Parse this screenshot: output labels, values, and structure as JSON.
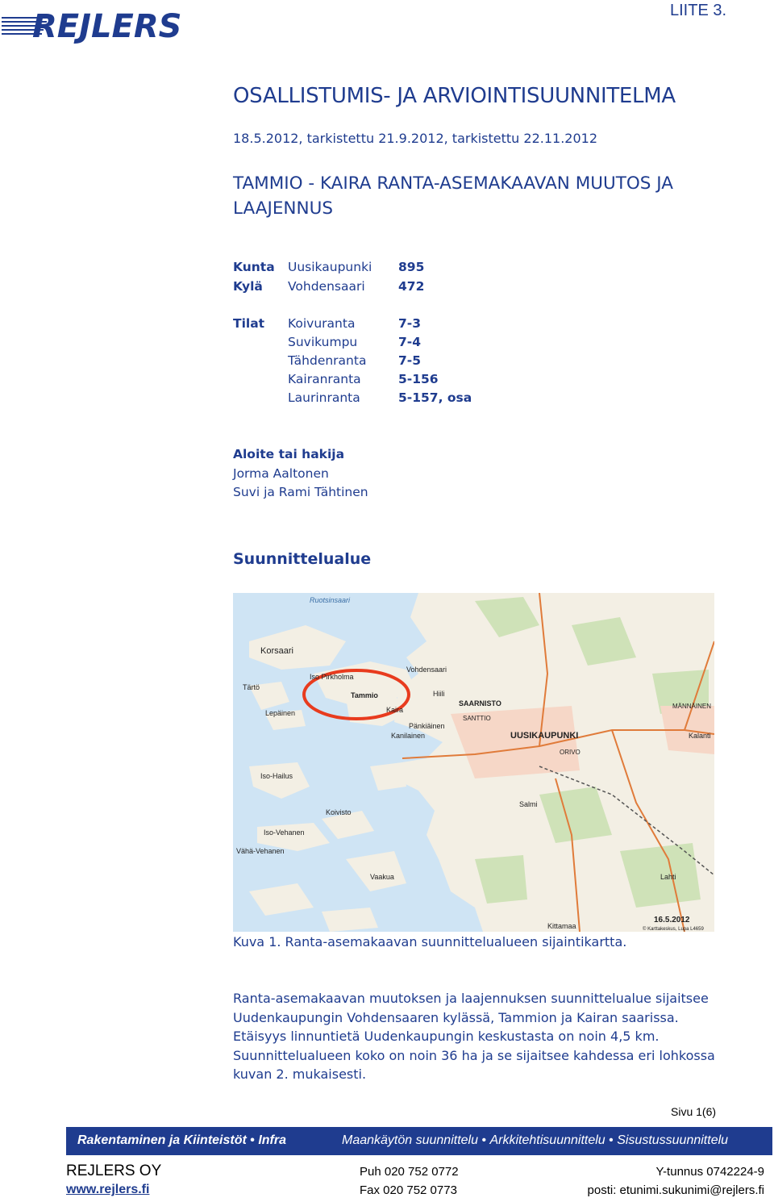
{
  "header": {
    "logo_text": "REJLERS",
    "appendix": "LIITE 3."
  },
  "document": {
    "title": "OSALLISTUMIS- JA ARVIOINTISUUNNITELMA",
    "dates": "18.5.2012, tarkistettu 21.9.2012, tarkistettu 22.11.2012",
    "subtitle": "TAMMIO - KAIRA RANTA-ASEMAKAAVAN MUUTOS JA LAAJENNUS"
  },
  "info": {
    "kunta": {
      "label": "Kunta",
      "name": "Uusikaupunki",
      "number": "895"
    },
    "kyla": {
      "label": "Kylä",
      "name": "Vohdensaari",
      "number": "472"
    },
    "tilat_label": "Tilat",
    "tilat": [
      {
        "name": "Koivuranta",
        "number": "7-3"
      },
      {
        "name": "Suvikumpu",
        "number": "7-4"
      },
      {
        "name": "Tähdenranta",
        "number": "7-5"
      },
      {
        "name": "Kairanranta",
        "number": "5-156"
      },
      {
        "name": "Laurinranta",
        "number": "5-157, osa"
      }
    ]
  },
  "applicant": {
    "heading": "Aloite tai hakija",
    "names": [
      "Jorma Aaltonen",
      "Suvi ja Rami Tähtinen"
    ]
  },
  "area": {
    "heading": "Suunnittelualue",
    "map_labels": {
      "sea": "Ruotsinsaari",
      "korsaari": "Korsaari",
      "iso_pirkholma": "Iso Pirkholma",
      "tammio": "Tammio",
      "kaira": "Kaira",
      "tarto": "Tärtö",
      "lepaisen": "Lepäinen",
      "vohdensaari": "Vohdensaari",
      "hiili": "Hiili",
      "saarnisto": "SAARNISTO",
      "santtio": "SANTTIO",
      "pankiainen": "Pänkiäinen",
      "kanilainen": "Kanilainen",
      "uusikaupunki": "UUSIKAUPUNKI",
      "iso_hailus": "Iso-Hailus",
      "iso_vehanen": "Iso-Vehanen",
      "koivisto": "Koivisto",
      "vaha_vehanen": "Vähä-Vehanen",
      "vaakua": "Vaakua",
      "kalanti": "Kalanti",
      "mannainen": "MÄNNÄINEN",
      "orivo": "ORIVO",
      "salmi": "Salmi",
      "lahti": "Lahti",
      "kittamaa": "Kittamaa",
      "date": "16.5.2012",
      "copyright": "© Karttakeskus, Lupa L4659"
    },
    "caption": "Kuva 1. Ranta-asemakaavan suunnittelualueen sijaintikartta.",
    "paragraph": "Ranta-asemakaavan muutoksen ja laajennuksen suunnittelualue sijaitsee Uudenkaupungin Vohdensaaren kylässä, Tammion ja Kairan saarissa. Etäisyys linnuntietä Uudenkaupungin keskustasta on noin 4,5 km. Suunnittelualueen koko on noin 36 ha ja se sijaitsee kahdessa eri lohkossa kuvan 2. mukaisesti."
  },
  "page": {
    "number": "Sivu 1(6)"
  },
  "footer": {
    "band_left": [
      "Rakentaminen ja Kiinteistöt",
      "Infra"
    ],
    "band_right": [
      "Maankäytön suunnittelu",
      "Arkkitehtisuunnittelu",
      "Sisustussuunnittelu"
    ],
    "company": "REJLERS  OY",
    "web": "www.rejlers.fi",
    "phone": "Puh  020 752 0772",
    "fax": "Fax  020 752 0773",
    "business_id": "Y-tunnus  0742224-9",
    "email": "posti: etunimi.sukunimi@rejlers.fi"
  },
  "colors": {
    "brand": "#1f3c8f",
    "water": "#cfe4f4",
    "land": "#f3efe4"
  }
}
